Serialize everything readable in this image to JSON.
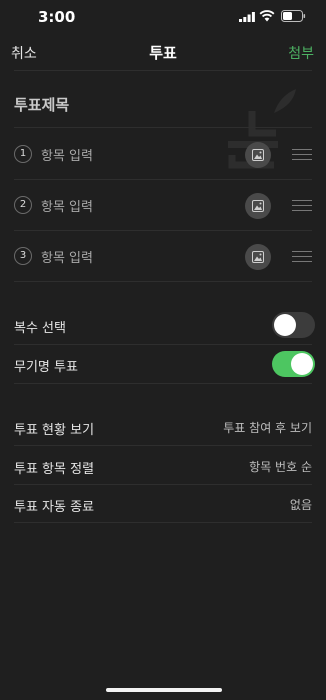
{
  "status_bar": {
    "time": "3:00"
  },
  "nav": {
    "cancel_label": "취소",
    "title": "투표",
    "attach_label": "첨부"
  },
  "poll": {
    "title_placeholder": "투표제목",
    "options": [
      {
        "number": "1",
        "placeholder": "항목 입력"
      },
      {
        "number": "2",
        "placeholder": "항목 입력"
      },
      {
        "number": "3",
        "placeholder": "항목 입력"
      }
    ]
  },
  "toggles": {
    "multi_select": {
      "label": "복수 선택",
      "state": "off"
    },
    "anonymous": {
      "label": "무기명 투표",
      "state": "on"
    }
  },
  "settings": [
    {
      "label": "투표 현황 보기",
      "value": "투표 참여 후 보기"
    },
    {
      "label": "투표 항목 정렬",
      "value": "항목 번호 순"
    },
    {
      "label": "투표 자동 종료",
      "value": "없음"
    }
  ],
  "colors": {
    "accent": "#4caf62",
    "toggle_on": "#4dc661",
    "background": "#1f1f1f"
  }
}
